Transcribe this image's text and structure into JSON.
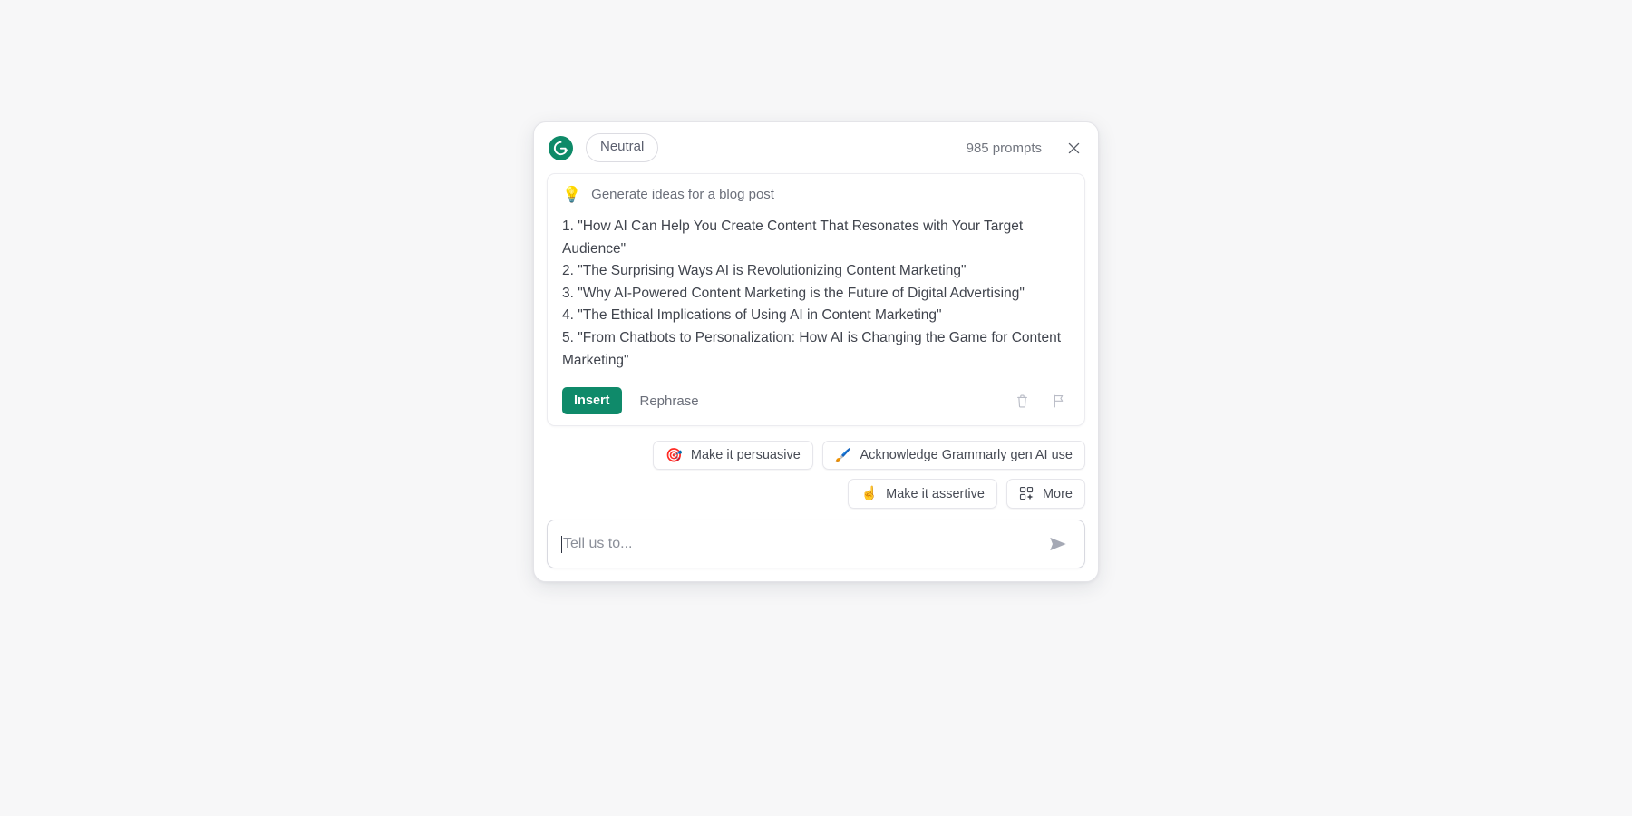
{
  "app": {
    "logo_icon": "grammarly-logo-icon",
    "background_color": "#f7f7f8",
    "accent_color": "#0f8a6a"
  },
  "header": {
    "tone_label": "Neutral",
    "prompt_count": "985 prompts",
    "close_icon": "close-icon"
  },
  "suggestion": {
    "bulb_icon": "💡",
    "title": "Generate ideas for a blog post",
    "ideas": [
      "1. \"How AI Can Help You Create Content That Resonates with Your Target Audience\"",
      "2. \"The Surprising Ways AI is Revolutionizing Content Marketing\"",
      "3. \"Why AI-Powered Content Marketing is the Future of Digital Advertising\"",
      "4. \"The Ethical Implications of Using AI in Content Marketing\"",
      "5. \"From Chatbots to Personalization: How AI is Changing the Game for Content Marketing\""
    ],
    "insert_label": "Insert",
    "rephrase_label": "Rephrase",
    "trash_icon": "trash-icon",
    "flag_icon": "flag-icon"
  },
  "chips": {
    "row1": [
      {
        "emoji": "🎯",
        "label": "Make it persuasive",
        "icon_name": "target-icon"
      },
      {
        "emoji": "🖌️",
        "label": "Acknowledge Grammarly gen AI use",
        "icon_name": "paintbrush-icon"
      }
    ],
    "row2": [
      {
        "emoji": "☝️",
        "label": "Make it assertive",
        "icon_name": "pointing-finger-icon"
      },
      {
        "emoji": "",
        "label": "More",
        "icon_name": "grid-sparkle-icon"
      }
    ]
  },
  "input": {
    "placeholder": "Tell us to...",
    "value": "",
    "send_icon": "send-icon"
  }
}
